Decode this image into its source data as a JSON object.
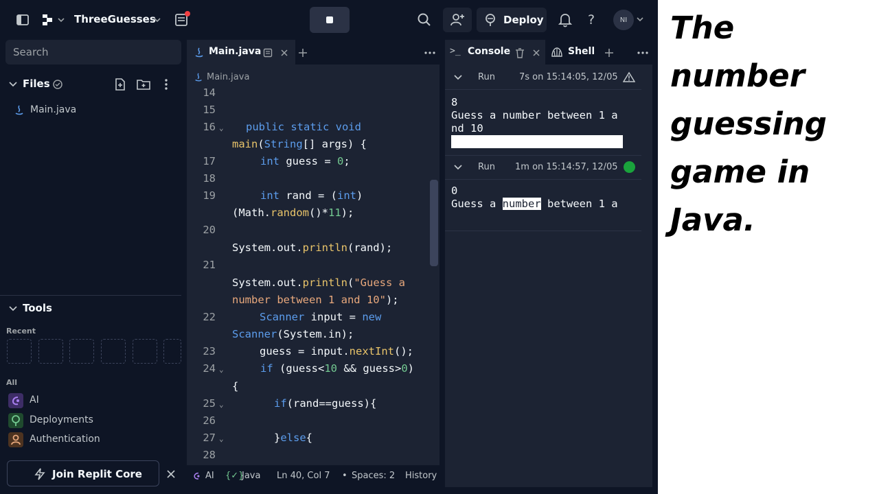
{
  "header": {
    "project_name": "ThreeGuesses",
    "deploy_label": "Deploy",
    "avatar_initials": "NI"
  },
  "sidebar": {
    "search_placeholder": "Search",
    "files_label": "Files",
    "files": [
      {
        "name": "Main.java"
      }
    ],
    "tools_label": "Tools",
    "recent_label": "Recent",
    "all_label": "All",
    "tools": [
      {
        "label": "AI",
        "icon": "ai-icon"
      },
      {
        "label": "Deployments",
        "icon": "deployments-icon"
      },
      {
        "label": "Authentication",
        "icon": "authentication-icon"
      }
    ],
    "join_core_label": "Join Replit Core"
  },
  "editor": {
    "tab_label": "Main.java",
    "breadcrumb": "Main.java",
    "line_numbers": {
      "l14": "14",
      "l15": "15",
      "l16": "16",
      "l17": "17",
      "l18": "18",
      "l19": "19",
      "l20": "20",
      "l21": "21",
      "l22": "22",
      "l23": "23",
      "l24": "24",
      "l25": "25",
      "l26": "26",
      "l27": "27",
      "l28": "28"
    },
    "code": {
      "c16a_kw": "public static void",
      "c16b_fn": "main",
      "c16b_p1": "(",
      "c16b_ty": "String",
      "c16b_p2": "[] args) {",
      "c17_kw": "int",
      "c17_p1": " guess = ",
      "c17_num": "0",
      "c17_p2": ";",
      "c19a_kw": "int",
      "c19a_p1": " rand = (",
      "c19a_kw2": "int",
      "c19a_p2": ")",
      "c19b_p1": "(Math.",
      "c19b_fn": "random",
      "c19b_p2": "()*",
      "c19b_num": "11",
      "c19b_p3": ");",
      "c20_p1": "System.out.",
      "c20_fn": "println",
      "c20_p2": "(rand);",
      "c21a_p1": "System.out.",
      "c21a_fn": "println",
      "c21a_p2": "(",
      "c21a_str": "\"Guess a",
      "c21b_str": "number between 1 and 10\"",
      "c21b_p": ");",
      "c22a_ty": "Scanner",
      "c22a_p1": " input = ",
      "c22a_kw": "new",
      "c22b_ty": "Scanner",
      "c22b_p": "(System.in);",
      "c23_p1": "guess = input.",
      "c23_fn": "nextInt",
      "c23_p2": "();",
      "c24a_kw": "if",
      "c24a_p1": " (guess<",
      "c24a_num": "10",
      "c24a_p2": " && guess>",
      "c24a_num2": "0",
      "c24a_p3": ")",
      "c24b": "{",
      "c25_kw": "if",
      "c25_p": "(rand==guess){",
      "c27_p1": "}",
      "c27_kw": "else",
      "c27_p2": "{"
    },
    "status": {
      "ai": "AI",
      "language": "Java",
      "position": "Ln 40, Col 7",
      "spaces": "Spaces: 2",
      "history": "History"
    }
  },
  "console": {
    "tab_console": "Console",
    "tab_shell": "Shell",
    "runs": [
      {
        "label": "Run",
        "meta": "7s on 15:14:05, 12/05",
        "status_icon": "warning-icon",
        "output": [
          "8",
          "Guess a number between 1 a",
          "nd 10"
        ]
      },
      {
        "label": "Run",
        "meta": "1m on 15:14:57, 12/05",
        "status_icon": "success-dot",
        "output": [
          "0",
          "Guess a ",
          "number",
          " between 1 a"
        ]
      }
    ]
  },
  "caption": {
    "text": "The number guessing game in Java."
  },
  "colors": {
    "bg": "#0e1525",
    "panel": "#1c2333",
    "keyword": "#5c9ded",
    "number": "#73c991",
    "function": "#e9c46a",
    "string": "#e8a87c",
    "success": "#1aa33c"
  }
}
